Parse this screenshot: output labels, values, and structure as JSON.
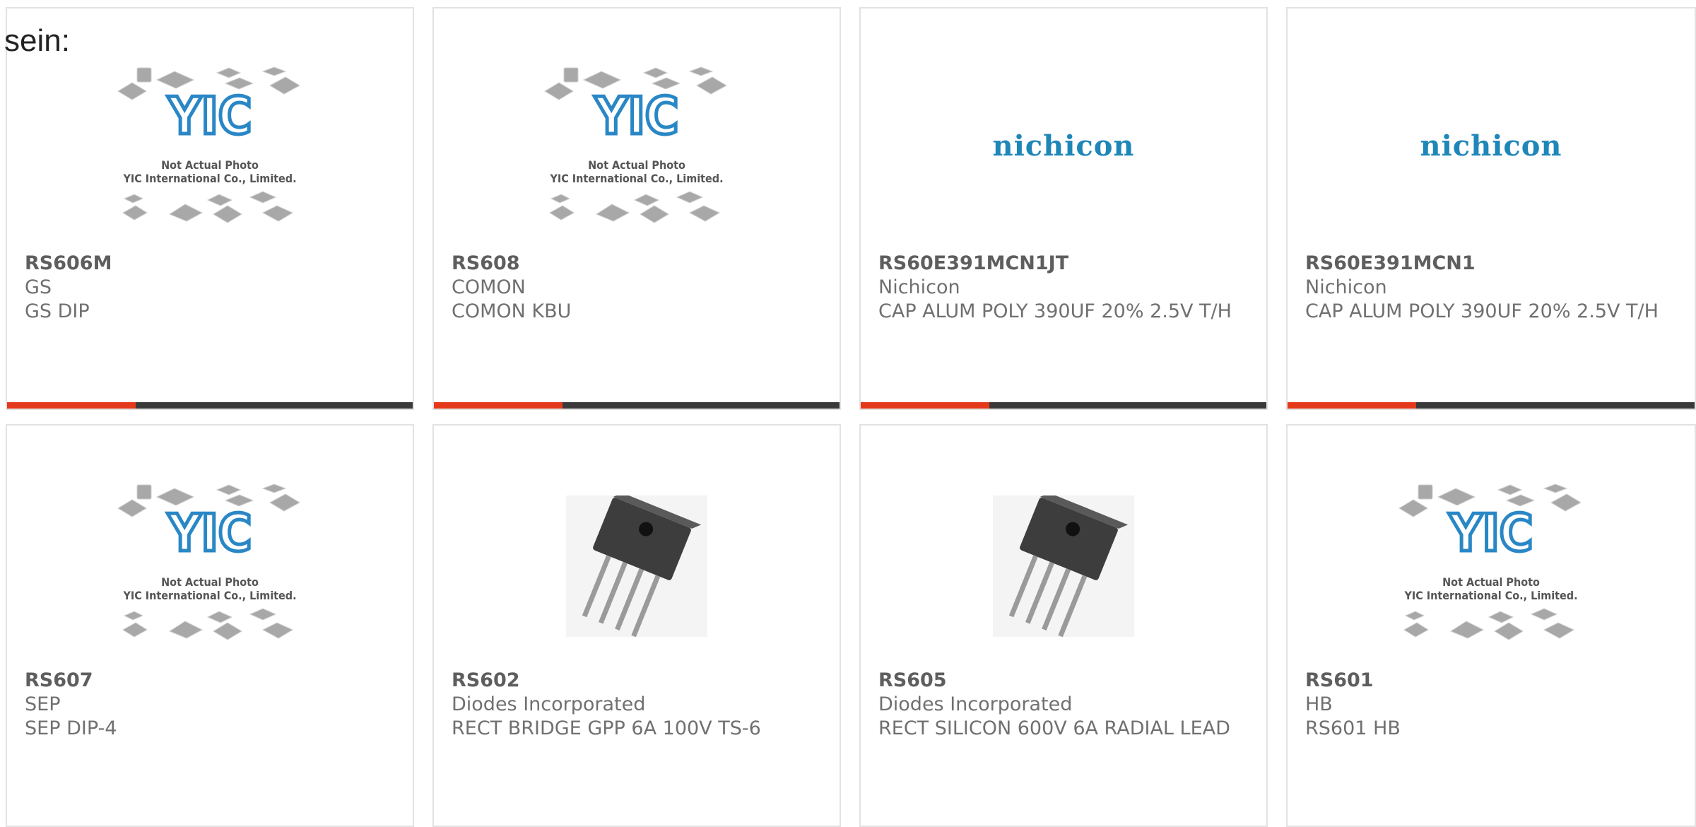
{
  "intro_text": "sein:",
  "placeholder_image": {
    "line1": "Not Actual Photo",
    "line2": "YIC International Co., Limited.",
    "logo": "YIC"
  },
  "brand_logo": "nichicon",
  "accent_color": "#e5391c",
  "products": [
    {
      "part": "RS606M",
      "mfr": "GS",
      "desc": "GS DIP",
      "image": "yic-placeholder"
    },
    {
      "part": "RS608",
      "mfr": "COMON",
      "desc": "COMON KBU",
      "image": "yic-placeholder"
    },
    {
      "part": "RS60E391MCN1JT",
      "mfr": "Nichicon",
      "desc": "CAP ALUM POLY 390UF 20% 2.5V T/H",
      "image": "nichicon-logo"
    },
    {
      "part": "RS60E391MCN1",
      "mfr": "Nichicon",
      "desc": "CAP ALUM POLY 390UF 20% 2.5V T/H",
      "image": "nichicon-logo"
    },
    {
      "part": "RS607",
      "mfr": "SEP",
      "desc": "SEP DIP-4",
      "image": "yic-placeholder"
    },
    {
      "part": "RS602",
      "mfr": "Diodes Incorporated",
      "desc": "RECT BRIDGE GPP 6A 100V TS-6",
      "image": "bridge-rectifier"
    },
    {
      "part": "RS605",
      "mfr": "Diodes Incorporated",
      "desc": "RECT SILICON 600V 6A RADIAL LEAD",
      "image": "bridge-rectifier"
    },
    {
      "part": "RS601",
      "mfr": "HB",
      "desc": "RS601 HB",
      "image": "yic-placeholder"
    }
  ]
}
